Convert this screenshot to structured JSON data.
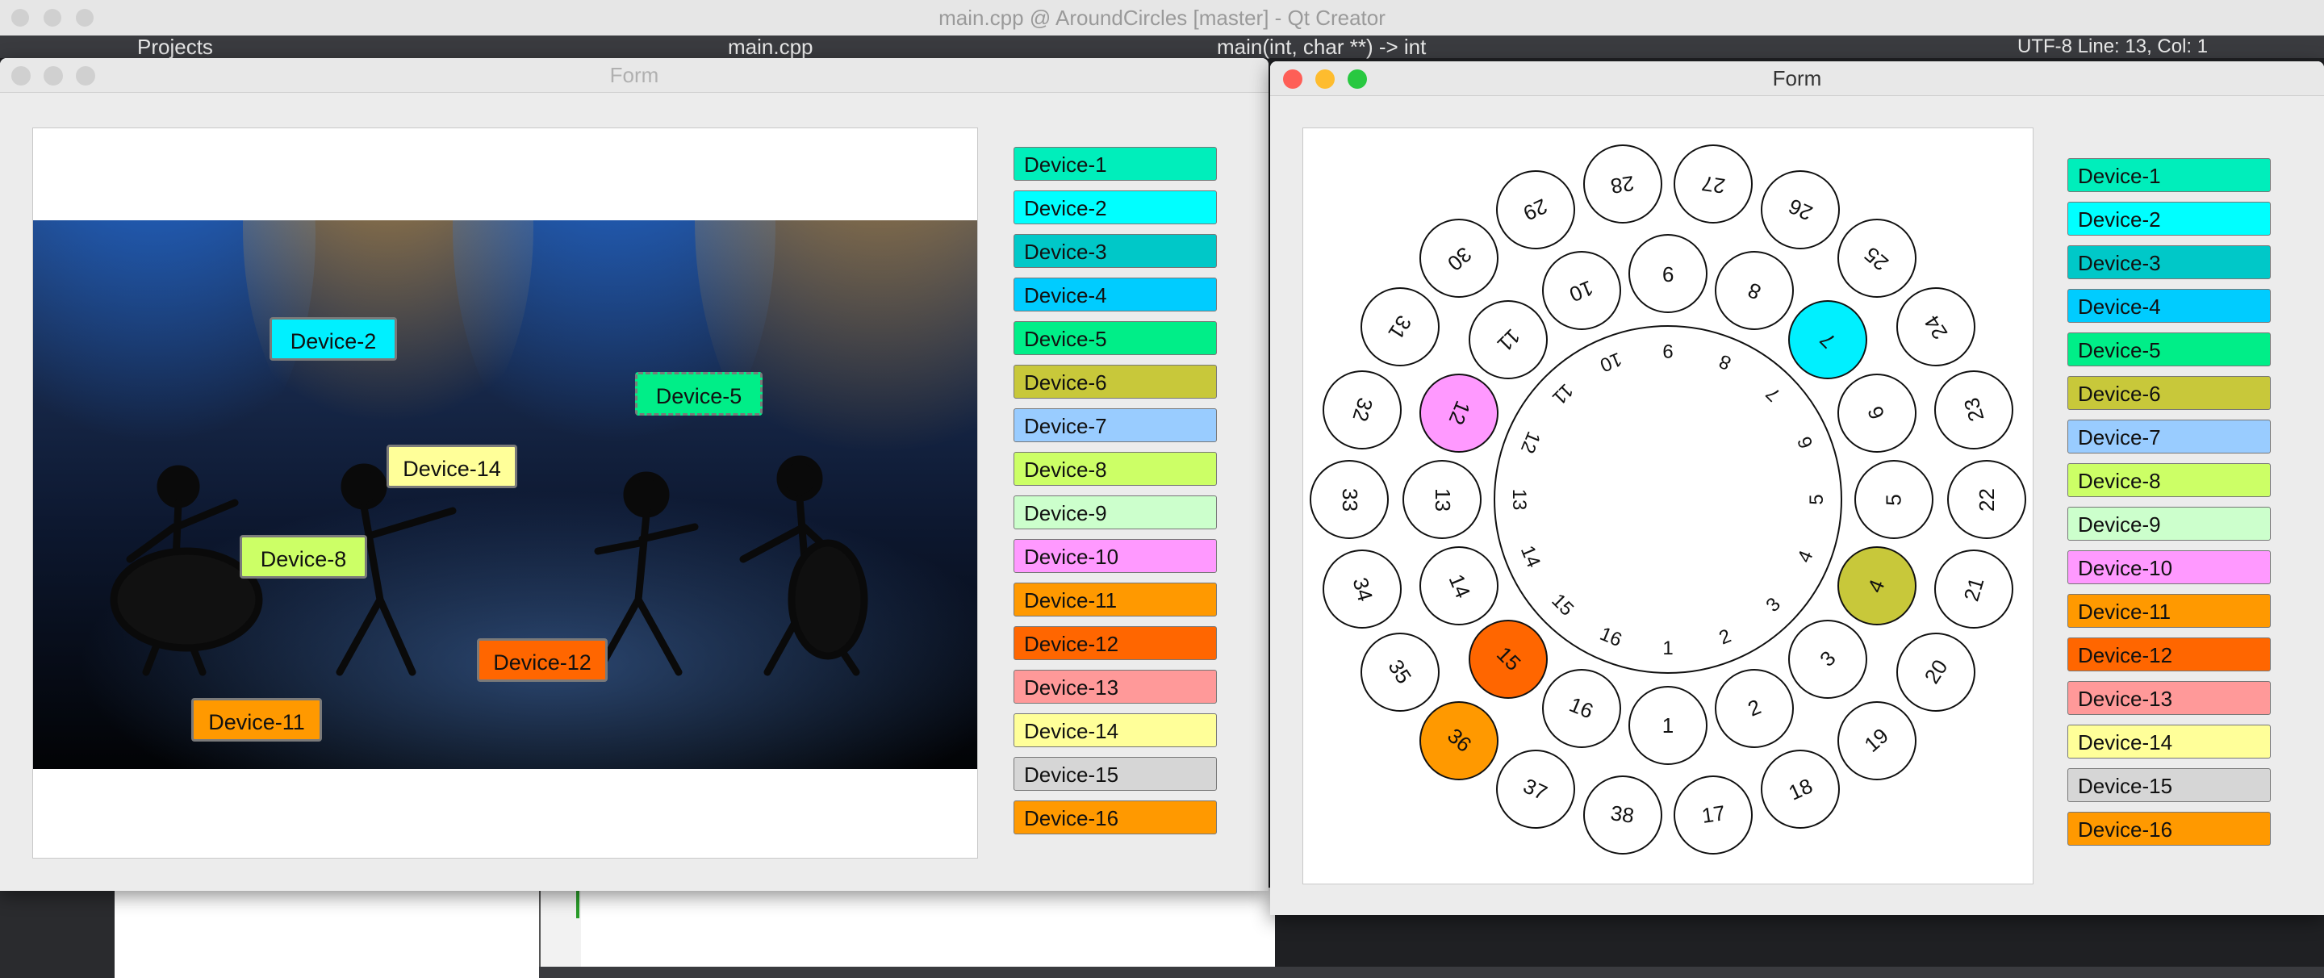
{
  "qt": {
    "title": "main.cpp @ AroundCircles [master] - Qt Creator",
    "projects_label": "Projects",
    "file_tab": "main.cpp",
    "function_combo": "main(int, char **) -> int",
    "status": "UTF-8 Line: 13, Col: 1"
  },
  "form_left": {
    "title": "Form",
    "devices": [
      "Device-1",
      "Device-2",
      "Device-3",
      "Device-4",
      "Device-5",
      "Device-6",
      "Device-7",
      "Device-8",
      "Device-9",
      "Device-10",
      "Device-11",
      "Device-12",
      "Device-13",
      "Device-14",
      "Device-15",
      "Device-16"
    ],
    "stage_labels": [
      {
        "text": "Device-2",
        "color": "#00f0ff"
      },
      {
        "text": "Device-5",
        "color": "#00ee88"
      },
      {
        "text": "Device-14",
        "color": "#ffff99"
      },
      {
        "text": "Device-8",
        "color": "#ccff66"
      },
      {
        "text": "Device-12",
        "color": "#ff6600"
      },
      {
        "text": "Device-11",
        "color": "#ff9900"
      }
    ]
  },
  "form_right": {
    "title": "Form",
    "devices": [
      "Device-1",
      "Device-2",
      "Device-3",
      "Device-4",
      "Device-5",
      "Device-6",
      "Device-7",
      "Device-8",
      "Device-9",
      "Device-10",
      "Device-11",
      "Device-12",
      "Device-13",
      "Device-14",
      "Device-15",
      "Device-16"
    ],
    "inner_numbers": [
      "1",
      "2",
      "3",
      "4",
      "5",
      "6",
      "7",
      "8",
      "9",
      "10",
      "11",
      "12",
      "13",
      "14",
      "15",
      "16"
    ],
    "middle_ring": [
      "1",
      "2",
      "3",
      "4",
      "5",
      "6",
      "7",
      "8",
      "9",
      "10",
      "11",
      "12",
      "13",
      "14",
      "15",
      "16"
    ],
    "outer_ring": [
      "17",
      "18",
      "19",
      "20",
      "21",
      "22",
      "23",
      "24",
      "25",
      "26",
      "27",
      "28",
      "29",
      "30",
      "31",
      "32",
      "33",
      "34",
      "35",
      "36",
      "37",
      "38"
    ],
    "highlighted": {
      "4": "#c8c83a",
      "7": "#00f0ff",
      "12": "#ff99ff",
      "15": "#ff6600",
      "36": "#ff9900"
    }
  },
  "device_colors": [
    "#00eebb",
    "#00ffff",
    "#00c8c8",
    "#00ccff",
    "#00ee88",
    "#c8c83a",
    "#99ccff",
    "#ccff66",
    "#ccffcc",
    "#ff99ff",
    "#ff9900",
    "#ff6600",
    "#ff9999",
    "#ffff99",
    "#d6d6d6",
    "#ff9900"
  ],
  "traffic_lights": {
    "close": "#fe5f57",
    "minimize": "#febc2e",
    "zoom": "#28c840"
  }
}
